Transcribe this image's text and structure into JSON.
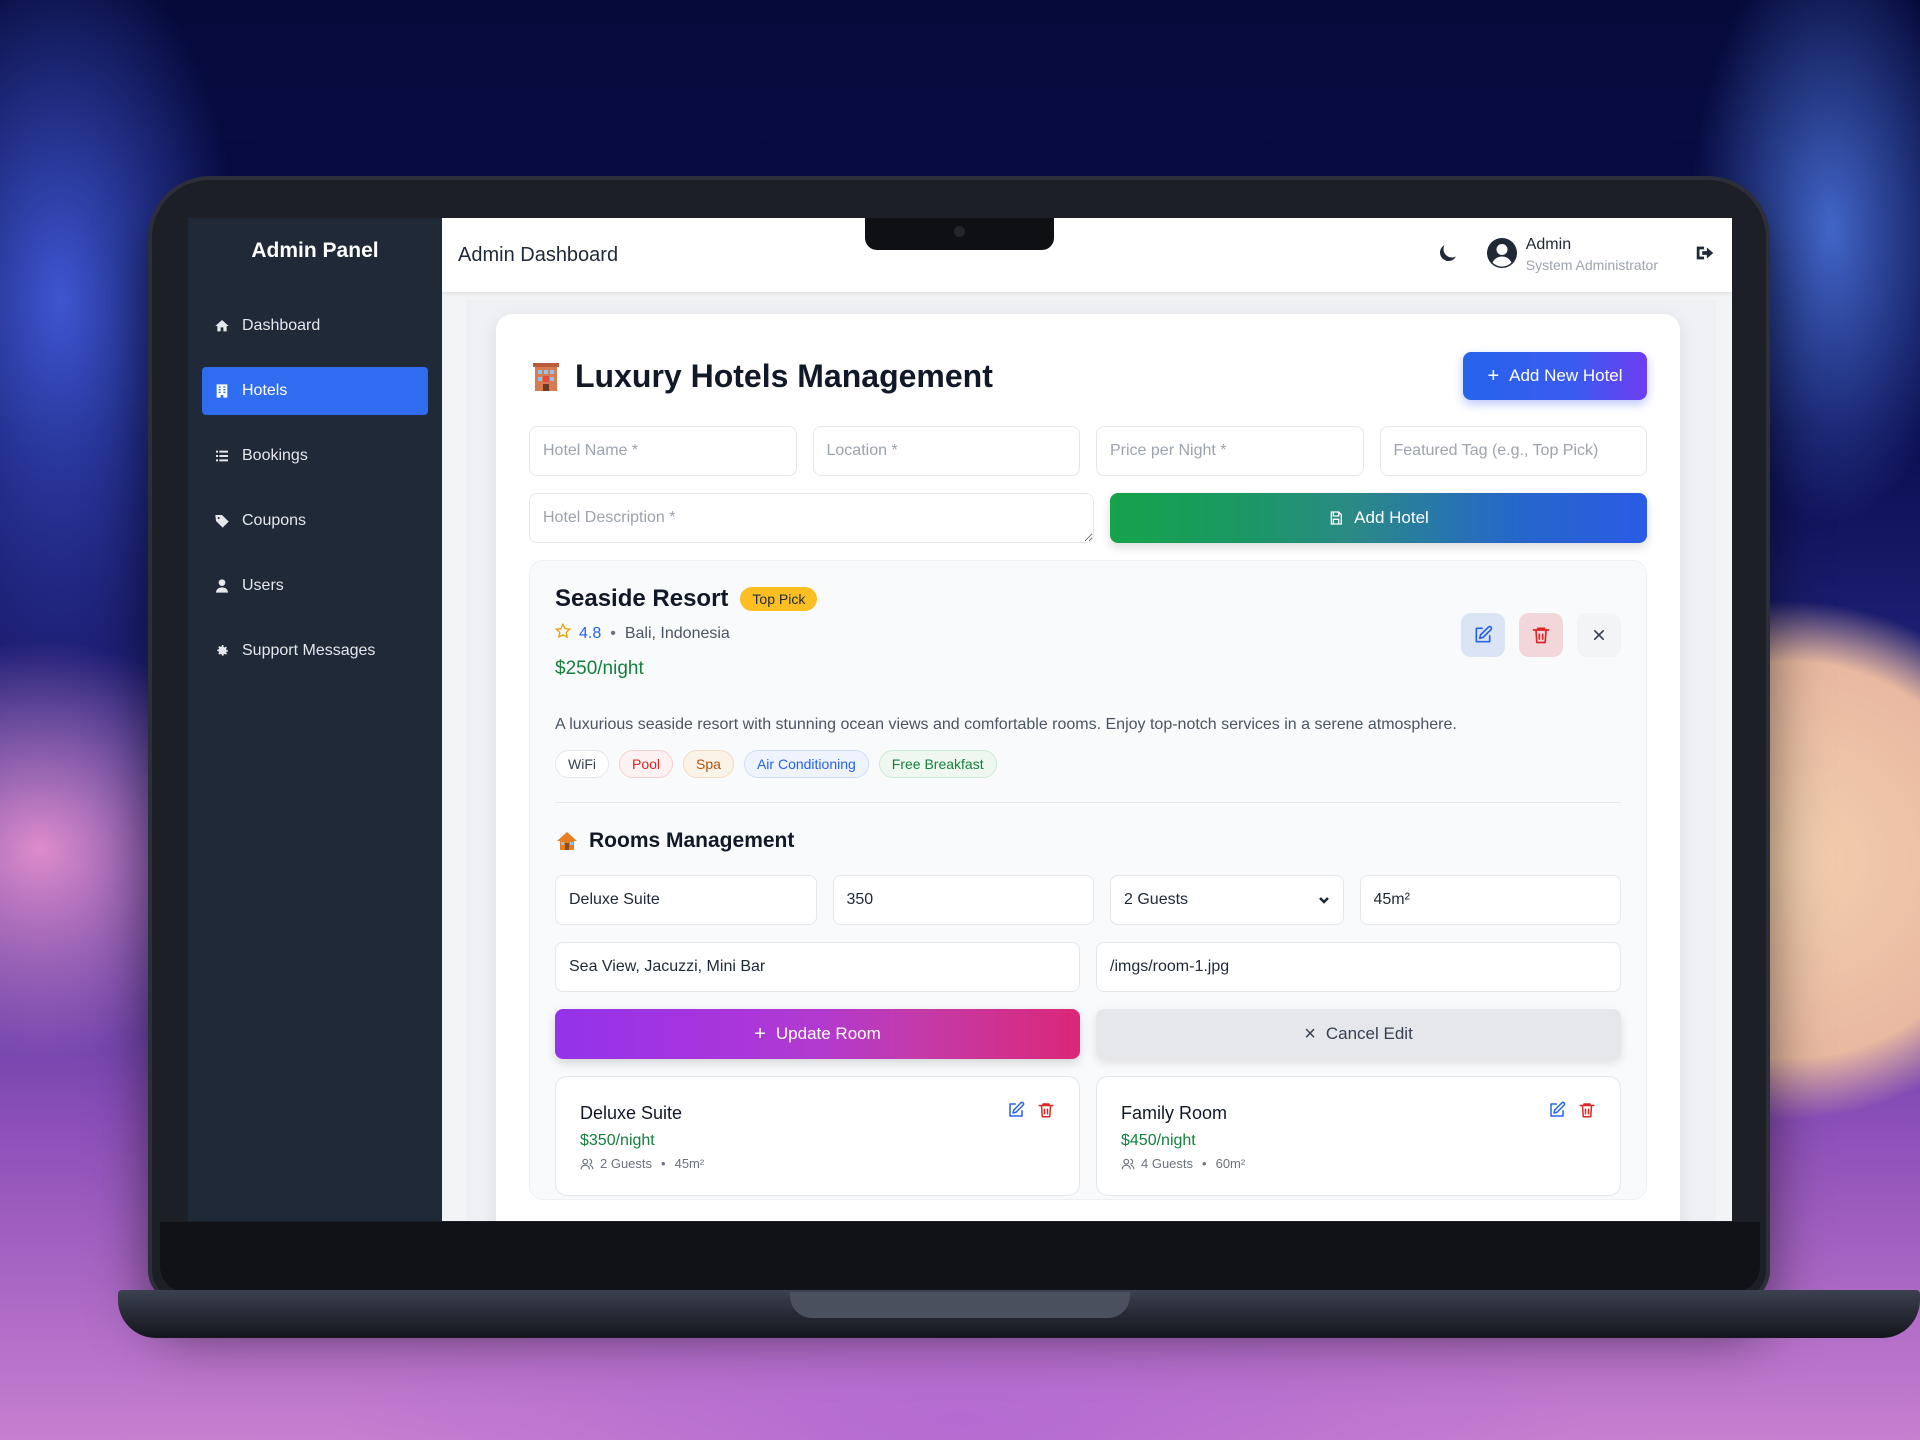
{
  "sidebar": {
    "brand": "Admin Panel",
    "items": [
      {
        "label": "Dashboard"
      },
      {
        "label": "Hotels"
      },
      {
        "label": "Bookings"
      },
      {
        "label": "Coupons"
      },
      {
        "label": "Users"
      },
      {
        "label": "Support Messages"
      }
    ]
  },
  "topbar": {
    "title": "Admin Dashboard",
    "user_name": "Admin",
    "user_role": "System Administrator"
  },
  "page": {
    "title": "Luxury Hotels Management",
    "add_new_label": "Add New Hotel"
  },
  "hotel_form": {
    "name_placeholder": "Hotel Name *",
    "location_placeholder": "Location *",
    "price_placeholder": "Price per Night *",
    "tag_placeholder": "Featured Tag (e.g., Top Pick)",
    "description_placeholder": "Hotel Description *",
    "submit_label": "Add Hotel"
  },
  "hotel": {
    "name": "Seaside Resort",
    "tag": "Top Pick",
    "rating": "4.8",
    "location": "Bali, Indonesia",
    "price": "$250/night",
    "description": "A luxurious seaside resort with stunning ocean views and comfortable rooms. Enjoy top-notch services in a serene atmosphere.",
    "amenities": [
      "WiFi",
      "Pool",
      "Spa",
      "Air Conditioning",
      "Free Breakfast"
    ]
  },
  "rooms": {
    "title": "Rooms Management",
    "form": {
      "name": "Deluxe Suite",
      "price": "350",
      "guests": "2 Guests",
      "size": "45m²",
      "features": "Sea View, Jacuzzi, Mini Bar",
      "image": "/imgs/room-1.jpg",
      "update_label": "Update Room",
      "cancel_label": "Cancel Edit"
    },
    "list": [
      {
        "name": "Deluxe Suite",
        "price": "$350/night",
        "guests": "2 Guests",
        "size": "45m²"
      },
      {
        "name": "Family Room",
        "price": "$450/night",
        "guests": "4 Guests",
        "size": "60m²"
      }
    ]
  },
  "colors": {
    "sidebar_bg": "#1f2937",
    "active_nav": "#2f6cf0",
    "price_green": "#15803d",
    "rating_blue": "#2563eb",
    "tag_yellow": "#fbbf24"
  }
}
